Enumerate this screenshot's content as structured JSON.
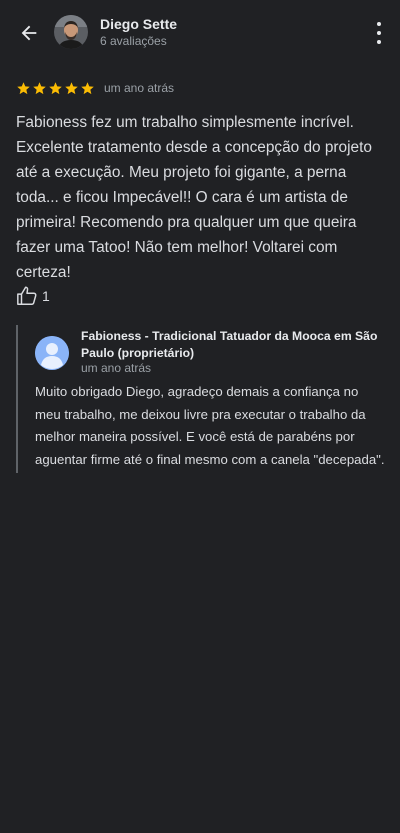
{
  "reviewer": {
    "name": "Diego Sette",
    "reviews_count": "6 avaliações"
  },
  "review": {
    "rating": 5,
    "max_rating": 5,
    "time": "um ano atrás",
    "text": "Fabioness fez um trabalho simplesmente incrível. Excelente tratamento desde a concepção do projeto até a execução. Meu projeto foi gigante, a perna toda... e ficou Impecável!! O cara é um artista de primeira! Recomendo pra qualquer um que queira fazer uma Tatoo! Não tem melhor! Voltarei com certeza!",
    "likes": "1"
  },
  "owner_reply": {
    "name": "Fabioness - Tradicional Tatuador da Mooca em São Paulo (proprietário)",
    "time": "um ano atrás",
    "text": "Muito obrigado Diego, agradeço demais a confiança no meu trabalho, me deixou livre pra executar o trabalho da melhor maneira possível. E você está de parabéns por aguentar firme até o final mesmo com a canela \"decepada\"."
  },
  "icons": {
    "back": "arrow-back-icon",
    "more": "more-vert-icon",
    "star": "star-icon",
    "like": "thumb-up-icon",
    "owner_avatar": "person-icon"
  },
  "colors": {
    "background": "#202124",
    "star": "#fbbc04",
    "text_primary": "#e8eaed",
    "text_secondary": "#9aa0a6",
    "owner_avatar": "#8ab4f8",
    "reply_border": "#5f6368"
  }
}
